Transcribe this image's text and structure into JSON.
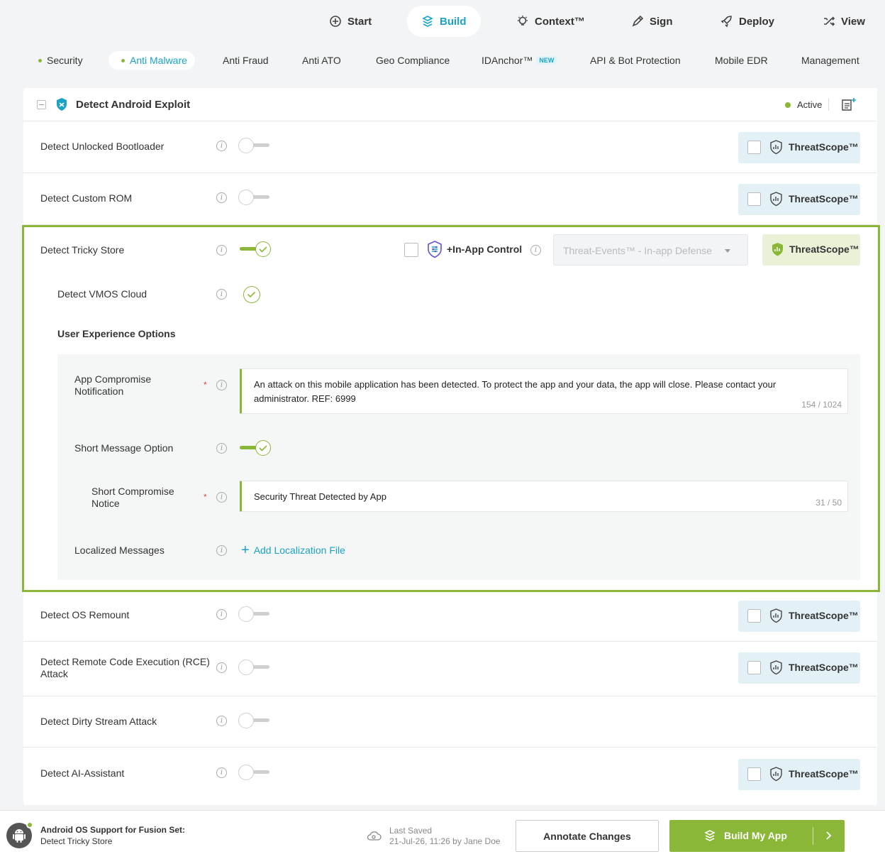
{
  "nav": {
    "items": [
      {
        "label": "Start",
        "icon": "plus-circle-icon"
      },
      {
        "label": "Build",
        "icon": "build-icon"
      },
      {
        "label": "Context™",
        "icon": "lightbulb-icon"
      },
      {
        "label": "Sign",
        "icon": "pen-icon"
      },
      {
        "label": "Deploy",
        "icon": "rocket-icon"
      },
      {
        "label": "View",
        "icon": "shuffle-icon"
      }
    ],
    "active": "Build"
  },
  "subnav": {
    "items": [
      {
        "label": "Security"
      },
      {
        "label": "Anti Malware"
      },
      {
        "label": "Anti Fraud"
      },
      {
        "label": "Anti ATO"
      },
      {
        "label": "Geo Compliance"
      },
      {
        "label": "IDAnchor™",
        "badge": "NEW"
      },
      {
        "label": "API & Bot Protection"
      },
      {
        "label": "Mobile EDR"
      },
      {
        "label": "Management"
      }
    ],
    "active": "Anti Malware"
  },
  "card": {
    "title": "Detect Android Exploit",
    "status": "Active",
    "rows": [
      {
        "label": "Detect Unlocked Bootloader",
        "enabled": false,
        "threatscope": "ThreatScope™"
      },
      {
        "label": "Detect Custom ROM",
        "enabled": false,
        "threatscope": "ThreatScope™"
      },
      {
        "label": "Detect Tricky Store",
        "enabled": true,
        "threatscope": "ThreatScope™"
      },
      {
        "label": "Detect OS Remount",
        "enabled": false,
        "threatscope": "ThreatScope™"
      },
      {
        "label": "Detect Remote Code Execution (RCE) Attack",
        "enabled": false,
        "threatscope": "ThreatScope™"
      },
      {
        "label": "Detect Dirty Stream Attack",
        "enabled": false
      },
      {
        "label": "Detect AI-Assistant",
        "enabled": false,
        "threatscope": "ThreatScope™"
      }
    ],
    "in_app_control": {
      "label": "+In-App Control",
      "select_value": "Threat-Events™ - In-app Defense"
    },
    "sub_option": {
      "label": "Detect VMOS Cloud",
      "checked": true
    },
    "ux": {
      "title": "User Experience Options",
      "compromise_label": "App Compromise Notification",
      "compromise_text": "An attack on this mobile application has been detected. To protect the app and your data, the app will close. Please contact your administrator. REF: 6999",
      "compromise_count": "154 / 1024",
      "short_option_label": "Short Message Option",
      "short_option_enabled": true,
      "short_notice_label": "Short Compromise Notice",
      "short_notice_text": "Security Threat Detected by App",
      "short_notice_count": "31 / 50",
      "localized_label": "Localized Messages",
      "add_localization": "Add Localization File",
      "required_mark": "*"
    }
  },
  "footer": {
    "title": "Android OS Support for Fusion Set:",
    "subtitle": "Detect Tricky Store",
    "last_saved_label": "Last Saved",
    "last_saved_value": "21-Jul-26, 11:26 by Jane Doe",
    "annotate_label": "Annotate Changes",
    "build_label": "Build My App"
  },
  "colors": {
    "accent_green": "#8bb739",
    "accent_blue": "#1aa3c4",
    "threatscope_bg": "#e3f1f7"
  }
}
